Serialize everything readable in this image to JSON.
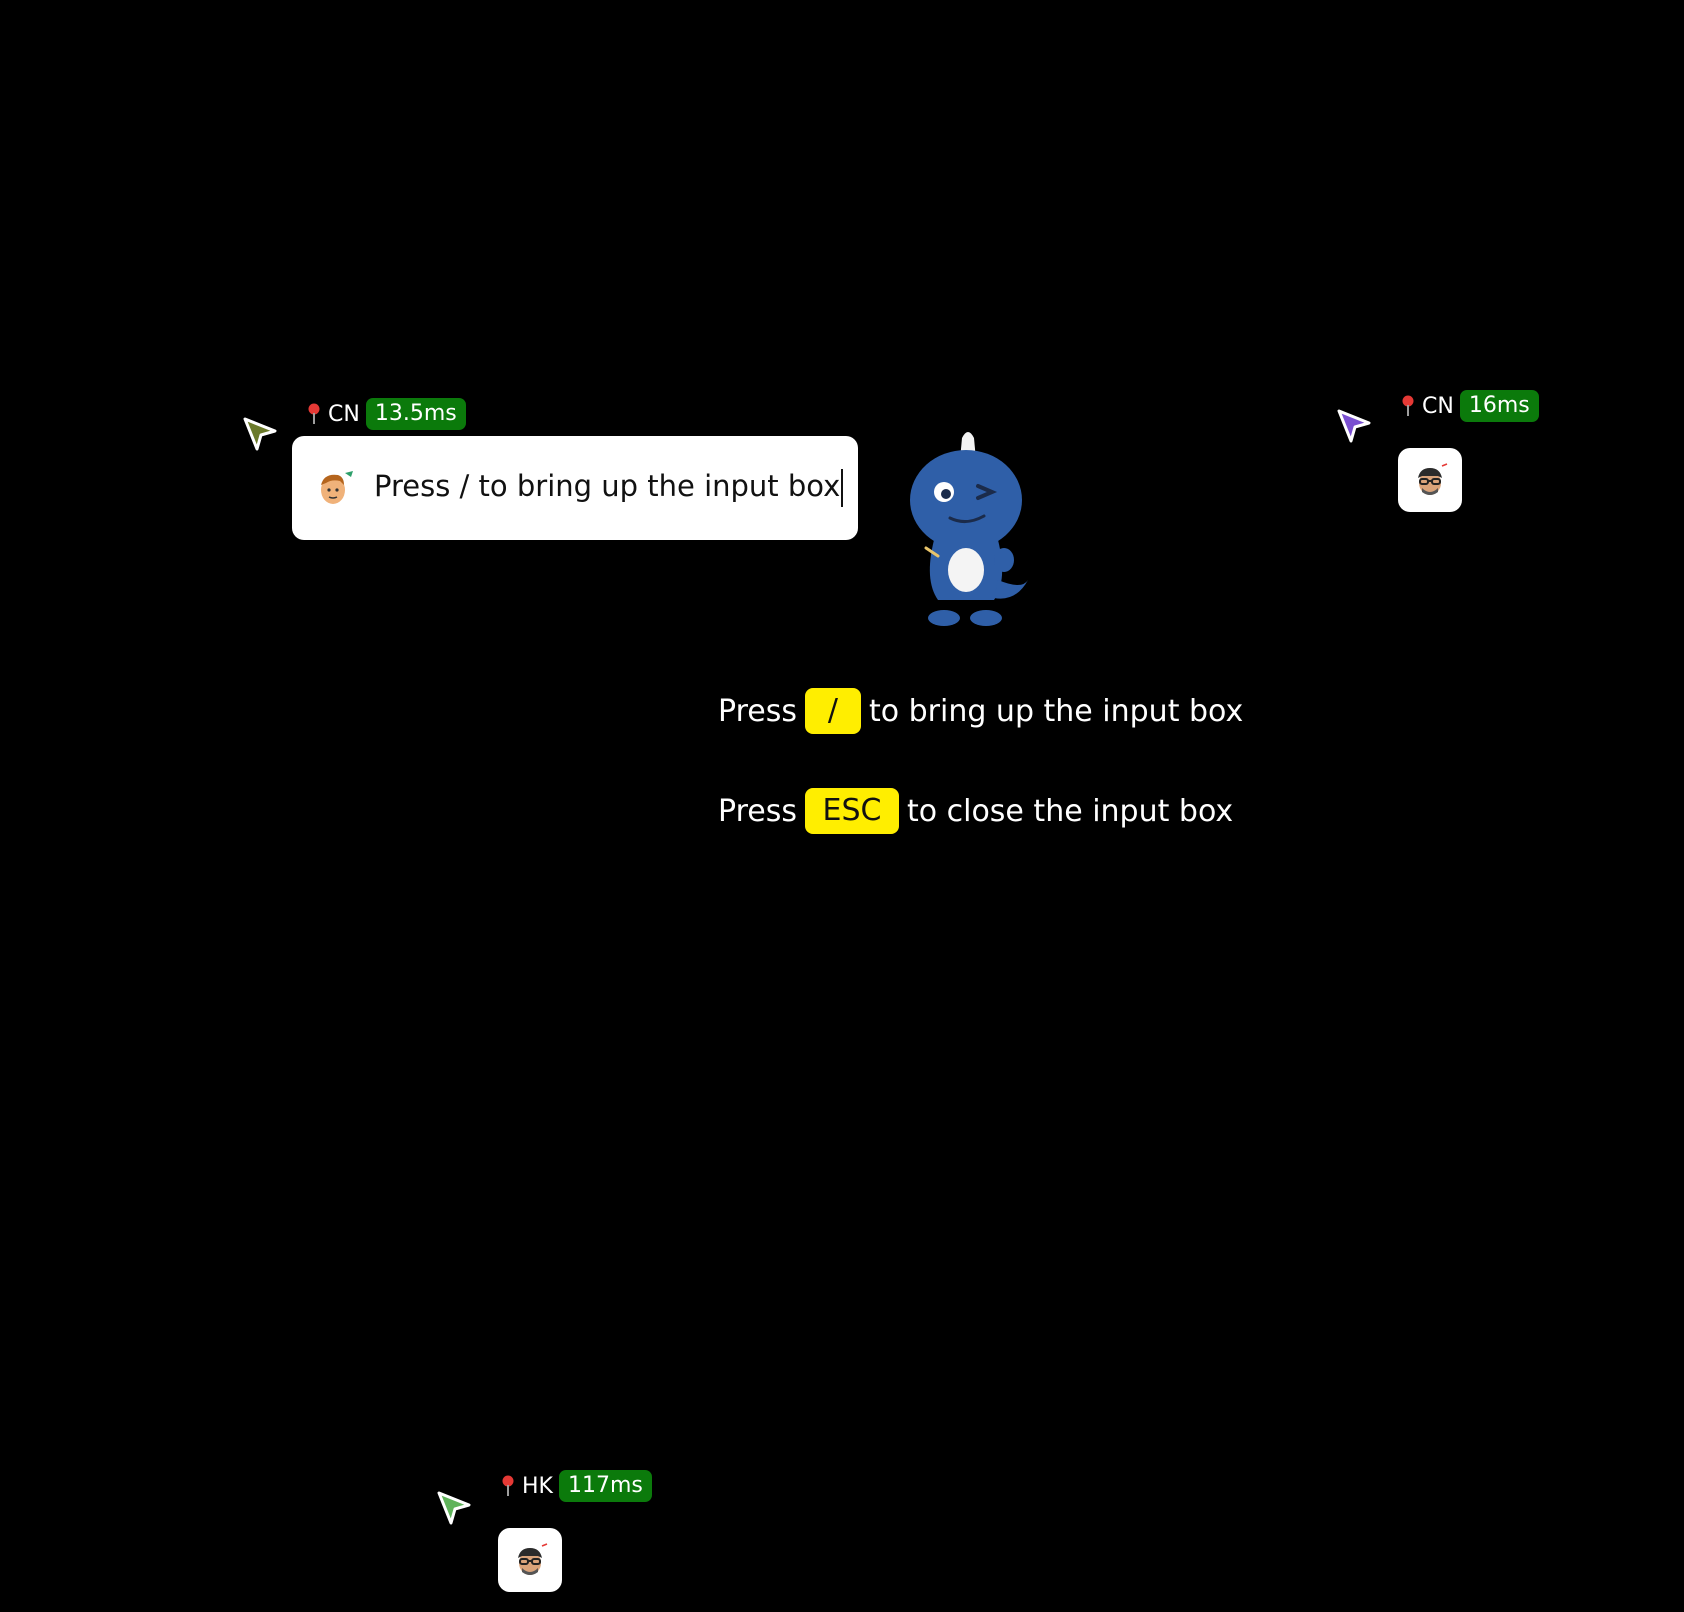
{
  "cursors": [
    {
      "id": "cursor-1",
      "region": "CN",
      "latency": "13.5ms",
      "color": "#6b7a2a"
    },
    {
      "id": "cursor-2",
      "region": "CN",
      "latency": "16ms",
      "color": "#7a4fd1"
    },
    {
      "id": "cursor-3",
      "region": "HK",
      "latency": "117ms",
      "color": "#5fb35a"
    }
  ],
  "chat": {
    "text": "Press / to bring up the input box"
  },
  "hints": {
    "line1": {
      "prefix": "Press",
      "key": "/",
      "suffix": "to bring up the input box"
    },
    "line2": {
      "prefix": "Press",
      "key": "ESC",
      "suffix": "to close the input box"
    }
  },
  "colors": {
    "background": "#000000",
    "latency_badge": "#0b7a0b",
    "key_badge": "#ffee00",
    "pin": "#e53935"
  },
  "icons": [
    "cursor-arrow-icon",
    "location-pin-icon",
    "avatar-icon",
    "dinosaur-mascot"
  ]
}
